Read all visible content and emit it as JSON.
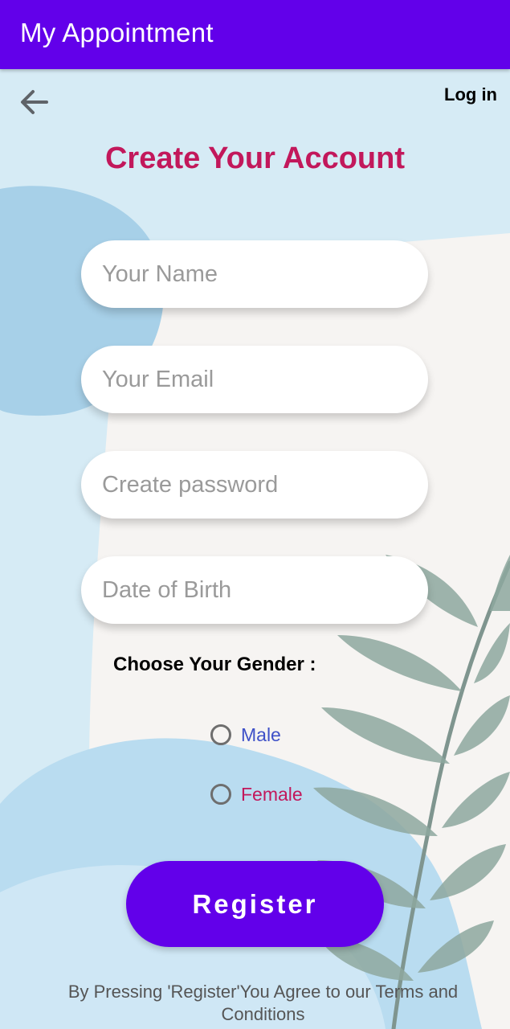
{
  "appbar": {
    "title": "My Appointment",
    "color": "#6200ea"
  },
  "nav": {
    "back_icon": "arrow-left-icon",
    "login_label": "Log in"
  },
  "form": {
    "title": "Create Your Account",
    "title_color": "#c2185b",
    "name_placeholder": "Your Name",
    "email_placeholder": "Your Email",
    "password_placeholder": "Create password",
    "dob_placeholder": "Date of Birth",
    "gender_label": "Choose Your Gender  :",
    "gender_options": [
      {
        "label": "Male",
        "selected": false,
        "color": "#3f51c8"
      },
      {
        "label": "Female",
        "selected": false,
        "color": "#c2185b"
      }
    ],
    "register_label": "Register",
    "terms_text": "By Pressing 'Register'You Agree to our Terms and Conditions"
  }
}
